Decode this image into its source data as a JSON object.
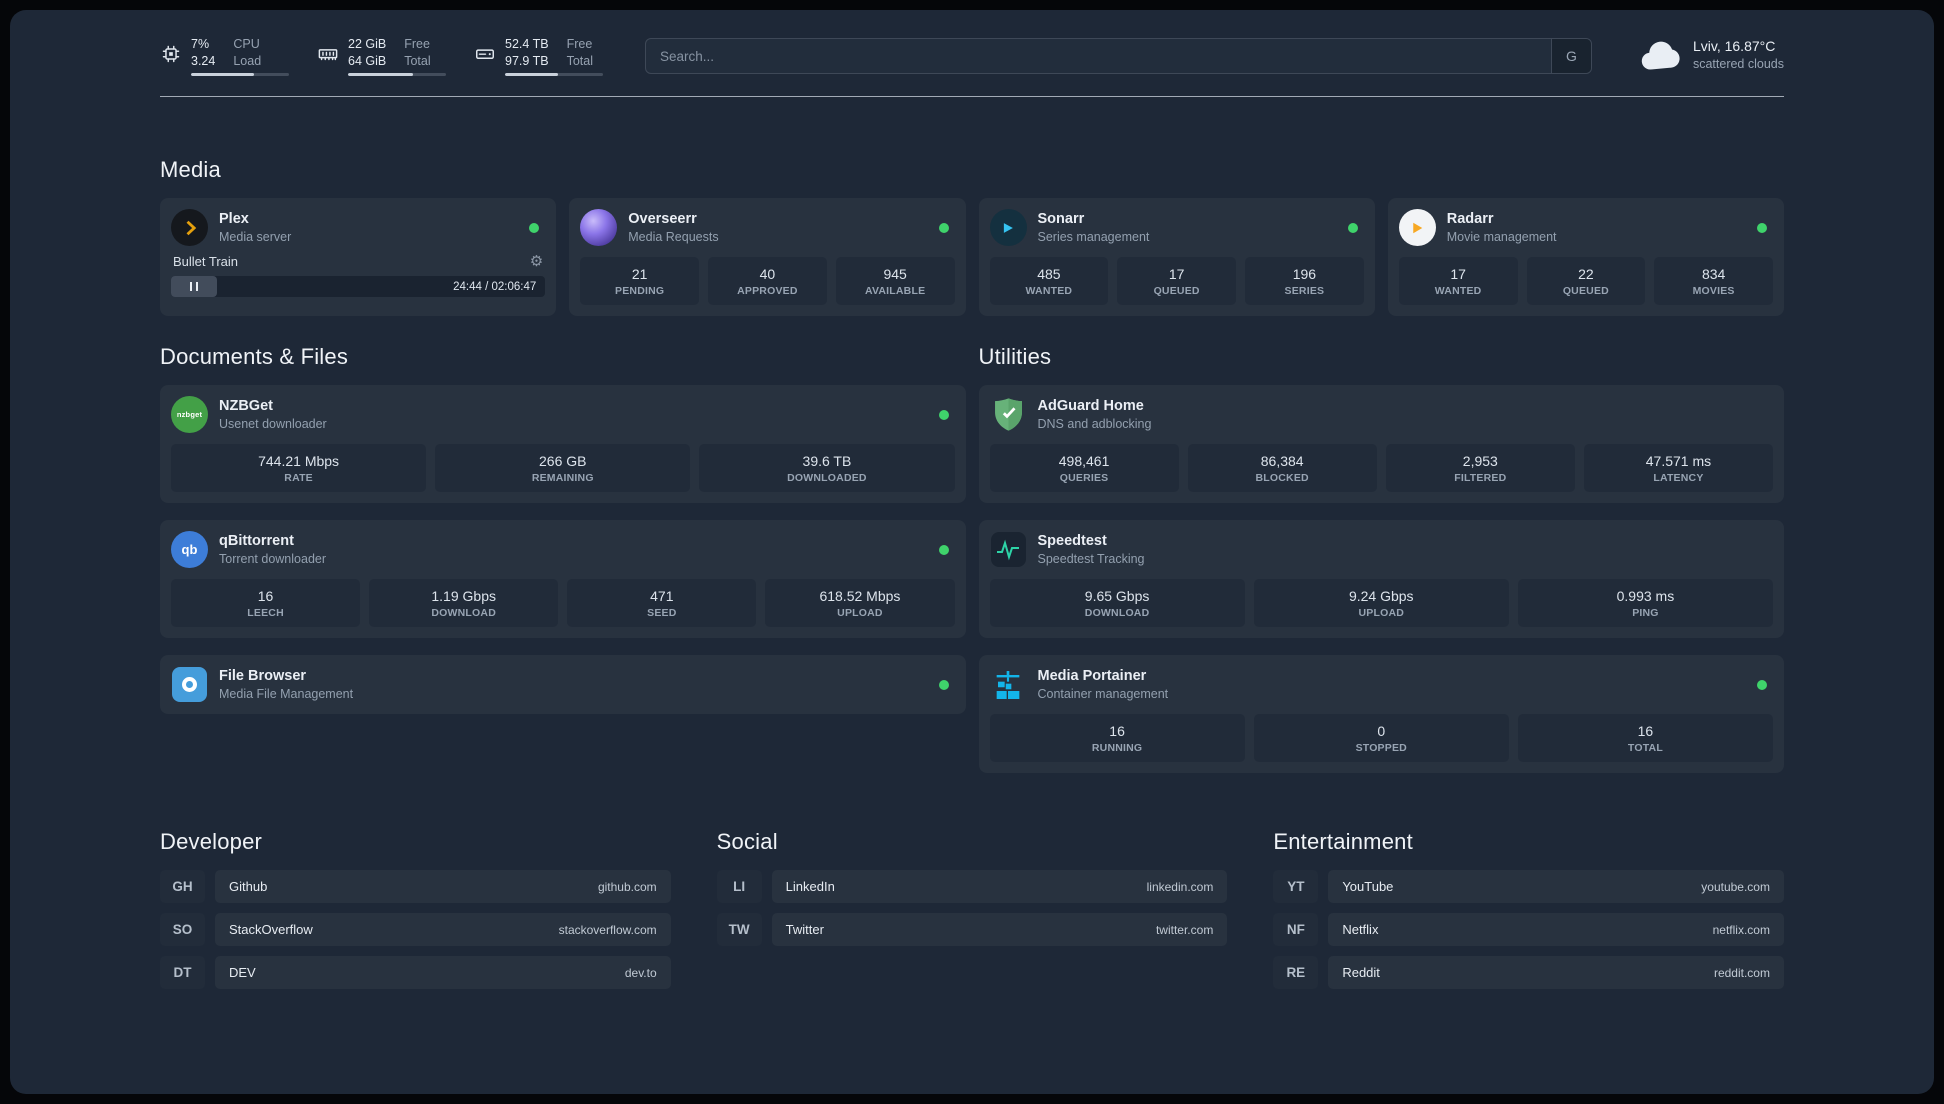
{
  "colors": {
    "panel_bg": "#1e2837",
    "card_bg": "#28323f",
    "tile_bg": "#212b39",
    "status_online": "#3fd36b",
    "plex_accent": "#e5a00d",
    "text_primary": "#ebeff5",
    "text_secondary": "#93a0af"
  },
  "topbar": {
    "resources": [
      {
        "icon": "cpu-icon",
        "value_top": "7%",
        "value_bottom": "3.24",
        "label_top": "CPU",
        "label_bottom": "Load",
        "bar_percent": 64
      },
      {
        "icon": "memory-icon",
        "value_top": "22 GiB",
        "value_bottom": "64 GiB",
        "label_top": "Free",
        "label_bottom": "Total",
        "bar_percent": 66
      },
      {
        "icon": "disk-icon",
        "value_top": "52.4 TB",
        "value_bottom": "97.9 TB",
        "label_top": "Free",
        "label_bottom": "Total",
        "bar_percent": 54
      }
    ],
    "search": {
      "placeholder": "Search...",
      "button_label": "G"
    },
    "weather": {
      "icon": "cloud-icon",
      "location": "Lviv, 16.87°C",
      "condition": "scattered clouds"
    }
  },
  "media": {
    "title": "Media",
    "cards": [
      {
        "icon": "plex-icon",
        "name": "Plex",
        "description": "Media server",
        "status": "online",
        "player": {
          "track_title": "Bullet Train",
          "elapsed_total": "24:44 / 02:06:47",
          "settings_icon": "gear-icon",
          "pause_icon": "pause-icon"
        }
      },
      {
        "icon": "overseerr-icon",
        "name": "Overseerr",
        "description": "Media Requests",
        "status": "online",
        "stats": [
          {
            "value": "21",
            "label": "PENDING"
          },
          {
            "value": "40",
            "label": "APPROVED"
          },
          {
            "value": "945",
            "label": "AVAILABLE"
          }
        ]
      },
      {
        "icon": "sonarr-icon",
        "name": "Sonarr",
        "description": "Series management",
        "status": "online",
        "stats": [
          {
            "value": "485",
            "label": "WANTED"
          },
          {
            "value": "17",
            "label": "QUEUED"
          },
          {
            "value": "196",
            "label": "SERIES"
          }
        ]
      },
      {
        "icon": "radarr-icon",
        "name": "Radarr",
        "description": "Movie management",
        "status": "online",
        "stats": [
          {
            "value": "17",
            "label": "WANTED"
          },
          {
            "value": "22",
            "label": "QUEUED"
          },
          {
            "value": "834",
            "label": "MOVIES"
          }
        ]
      }
    ]
  },
  "documents": {
    "title": "Documents & Files",
    "cards": [
      {
        "icon": "nzbget-icon",
        "icon_text": "nzbget",
        "name": "NZBGet",
        "description": "Usenet downloader",
        "status": "online",
        "stats": [
          {
            "value": "744.21 Mbps",
            "label": "RATE"
          },
          {
            "value": "266 GB",
            "label": "REMAINING"
          },
          {
            "value": "39.6 TB",
            "label": "DOWNLOADED"
          }
        ]
      },
      {
        "icon": "qbittorrent-icon",
        "icon_text": "qb",
        "name": "qBittorrent",
        "description": "Torrent downloader",
        "status": "online",
        "stats": [
          {
            "value": "16",
            "label": "LEECH"
          },
          {
            "value": "1.19 Gbps",
            "label": "DOWNLOAD"
          },
          {
            "value": "471",
            "label": "SEED"
          },
          {
            "value": "618.52 Mbps",
            "label": "UPLOAD"
          }
        ]
      },
      {
        "icon": "filebrowser-icon",
        "name": "File Browser",
        "description": "Media File Management",
        "status": "online",
        "stats": []
      }
    ]
  },
  "utilities": {
    "title": "Utilities",
    "cards": [
      {
        "icon": "adguard-icon",
        "name": "AdGuard Home",
        "description": "DNS and adblocking",
        "stats": [
          {
            "value": "498,461",
            "label": "QUERIES"
          },
          {
            "value": "86,384",
            "label": "BLOCKED"
          },
          {
            "value": "2,953",
            "label": "FILTERED"
          },
          {
            "value": "47.571 ms",
            "label": "LATENCY"
          }
        ]
      },
      {
        "icon": "speedtest-icon",
        "name": "Speedtest",
        "description": "Speedtest Tracking",
        "stats": [
          {
            "value": "9.65 Gbps",
            "label": "DOWNLOAD"
          },
          {
            "value": "9.24 Gbps",
            "label": "UPLOAD"
          },
          {
            "value": "0.993 ms",
            "label": "PING"
          }
        ]
      },
      {
        "icon": "portainer-icon",
        "name": "Media Portainer",
        "description": "Container management",
        "status": "online",
        "stats": [
          {
            "value": "16",
            "label": "RUNNING"
          },
          {
            "value": "0",
            "label": "STOPPED"
          },
          {
            "value": "16",
            "label": "TOTAL"
          }
        ]
      }
    ]
  },
  "bookmarks": [
    {
      "title": "Developer",
      "items": [
        {
          "abbr": "GH",
          "name": "Github",
          "url": "github.com"
        },
        {
          "abbr": "SO",
          "name": "StackOverflow",
          "url": "stackoverflow.com"
        },
        {
          "abbr": "DT",
          "name": "DEV",
          "url": "dev.to"
        }
      ]
    },
    {
      "title": "Social",
      "items": [
        {
          "abbr": "LI",
          "name": "LinkedIn",
          "url": "linkedin.com"
        },
        {
          "abbr": "TW",
          "name": "Twitter",
          "url": "twitter.com"
        }
      ]
    },
    {
      "title": "Entertainment",
      "items": [
        {
          "abbr": "YT",
          "name": "YouTube",
          "url": "youtube.com"
        },
        {
          "abbr": "NF",
          "name": "Netflix",
          "url": "netflix.com"
        },
        {
          "abbr": "RE",
          "name": "Reddit",
          "url": "reddit.com"
        }
      ]
    }
  ]
}
